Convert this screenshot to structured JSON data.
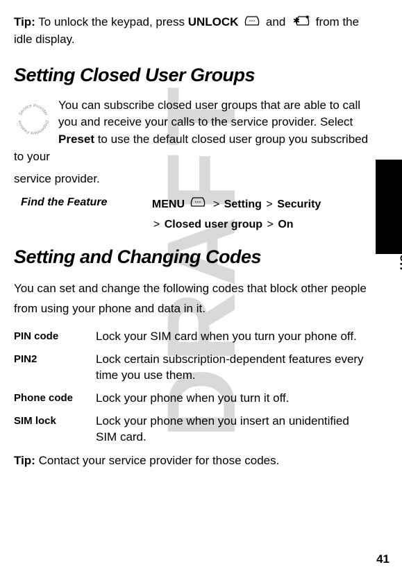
{
  "watermark": "DRAFT",
  "tip1_prefix": "Tip:",
  "tip1_text1": " To unlock the keypad, press ",
  "tip1_unlock": "UNLOCK",
  "tip1_text2": " and ",
  "tip1_text3": " from the idle display.",
  "section1_title": "Setting Closed User Groups",
  "section1_body_a": "You can subscribe closed user groups that are able to call you and receive your calls to the service provider. Select ",
  "section1_preset": "Preset",
  "section1_body_b": " to use the default closed user group you subscribed to your",
  "section1_body_c": "service provider.",
  "find_feature_label": "Find the Feature",
  "nav": {
    "menu": "MENU",
    "setting": "Setting",
    "security": "Security",
    "cug": "Closed user group",
    "on": "On"
  },
  "section2_title": "Setting and Changing Codes",
  "section2_intro": "You can set and change the following codes that block other people from using your phone and data in it.",
  "codes": [
    {
      "label": "PIN code",
      "desc": "Lock your SIM card when you turn your phone off."
    },
    {
      "label": "PIN2",
      "desc": "Lock certain subscription-dependent features every time you use them."
    },
    {
      "label": "Phone code",
      "desc": "Lock your phone when you turn it off."
    },
    {
      "label": "SIM lock",
      "desc": "Lock your phone when you insert an unidentified SIM card."
    }
  ],
  "tip2_prefix": "Tip:",
  "tip2_text": " Contact your service provider for those codes.",
  "side_label": "Basic Operation",
  "page_number": "41",
  "circle_text": "Service Provider Dependent Feature"
}
